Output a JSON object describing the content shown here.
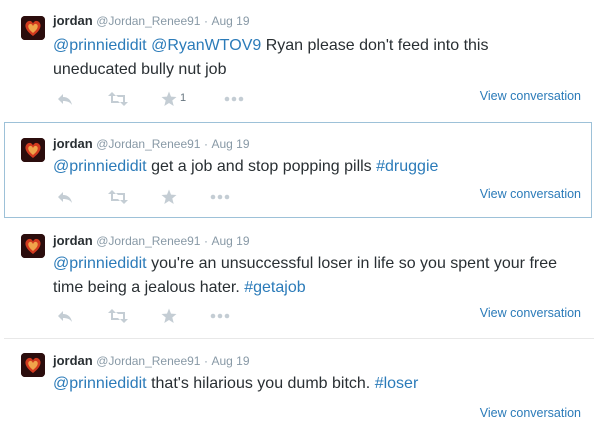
{
  "colors": {
    "link": "#2b7bb9",
    "muted": "#8899a6",
    "icon": "#c4cdd4",
    "highlight_border": "#9dc1d8"
  },
  "icons": {
    "reply": "reply-icon",
    "retweet": "retweet-icon",
    "favorite": "star-icon",
    "more": "more-dots-icon"
  },
  "tweets": [
    {
      "name": "jordan",
      "handle": "@Jordan_Renee91",
      "dot": "·",
      "time": "Aug 19",
      "parts": [
        {
          "type": "link",
          "text": "@prinniedidit"
        },
        {
          "type": "text",
          "text": " "
        },
        {
          "type": "link",
          "text": "@RyanWTOV9"
        },
        {
          "type": "text",
          "text": " Ryan please don't feed into this uneducated bully nut job"
        }
      ],
      "favorite_count": "1",
      "view_conversation": "View conversation",
      "highlighted": false
    },
    {
      "name": "jordan",
      "handle": "@Jordan_Renee91",
      "dot": "·",
      "time": "Aug 19",
      "parts": [
        {
          "type": "link",
          "text": "@prinniedidit"
        },
        {
          "type": "text",
          "text": " get a job and stop popping pills "
        },
        {
          "type": "link",
          "text": "#druggie"
        }
      ],
      "favorite_count": "",
      "view_conversation": "View conversation",
      "highlighted": true
    },
    {
      "name": "jordan",
      "handle": "@Jordan_Renee91",
      "dot": "·",
      "time": "Aug 19",
      "parts": [
        {
          "type": "link",
          "text": "@prinniedidit"
        },
        {
          "type": "text",
          "text": " you're an unsuccessful loser in life so you spent your free time being a jealous hater. "
        },
        {
          "type": "link",
          "text": "#getajob"
        }
      ],
      "favorite_count": "",
      "view_conversation": "View conversation",
      "highlighted": false
    },
    {
      "name": "jordan",
      "handle": "@Jordan_Renee91",
      "dot": "·",
      "time": "Aug 19",
      "parts": [
        {
          "type": "link",
          "text": "@prinniedidit"
        },
        {
          "type": "text",
          "text": " that's hilarious you dumb bitch. "
        },
        {
          "type": "link",
          "text": "#loser"
        }
      ],
      "favorite_count": "",
      "view_conversation": "View conversation",
      "highlighted": false
    }
  ]
}
